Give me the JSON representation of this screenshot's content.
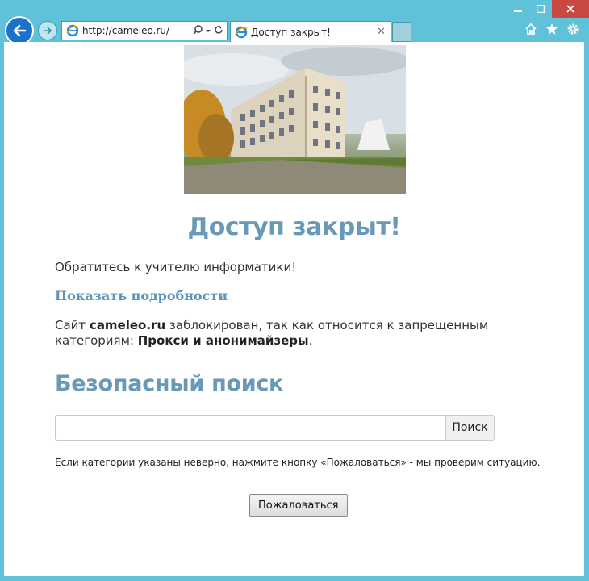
{
  "browser": {
    "url": "http://cameleo.ru/",
    "tab_title": "Доступ закрыт!",
    "accent": "#1a73c9",
    "frame_color": "#5fc2d8"
  },
  "page": {
    "title": "Доступ закрыт!",
    "message": "Обратитесь к учителю информатики!",
    "details_link": "Показать подробности",
    "blocked_prefix": "Сайт ",
    "blocked_site": "cameleo.ru",
    "blocked_middle": " заблокирован, так как относится к запрещенным категориям: ",
    "blocked_category": "Прокси и анонимайзеры",
    "blocked_suffix": ".",
    "safe_search_heading": "Безопасный поиск",
    "search_value": "",
    "search_button": "Поиск",
    "note": "Если категории указаны неверно, нажмите кнопку «Пожаловаться» - мы проверим ситуацию.",
    "complain_button": "Пожаловаться",
    "heading_color": "#6899b6"
  }
}
